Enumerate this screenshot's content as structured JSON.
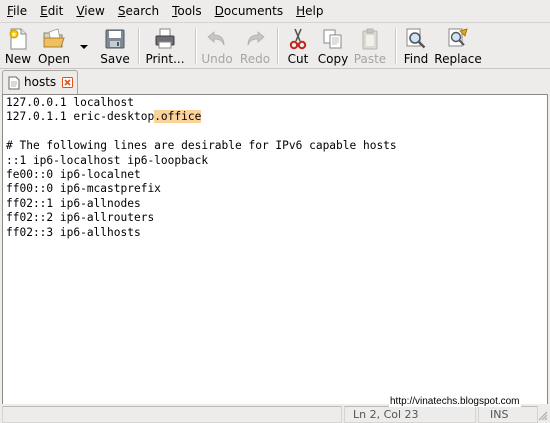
{
  "menubar": {
    "items": [
      {
        "mnemonic": "F",
        "rest": "ile"
      },
      {
        "mnemonic": "E",
        "rest": "dit"
      },
      {
        "mnemonic": "V",
        "rest": "iew"
      },
      {
        "mnemonic": "S",
        "rest": "earch"
      },
      {
        "mnemonic": "T",
        "rest": "ools"
      },
      {
        "mnemonic": "D",
        "rest": "ocuments"
      },
      {
        "mnemonic": "H",
        "rest": "elp"
      }
    ]
  },
  "toolbar": {
    "new_label": "New",
    "open_label": "Open",
    "save_label": "Save",
    "print_label": "Print...",
    "undo_label": "Undo",
    "redo_label": "Redo",
    "cut_label": "Cut",
    "copy_label": "Copy",
    "paste_label": "Paste",
    "find_label": "Find",
    "replace_label": "Replace"
  },
  "tab": {
    "label": "hosts"
  },
  "editor": {
    "lines": [
      {
        "text": "127.0.0.1 localhost"
      },
      {
        "text": "127.0.1.1 eric-desktop",
        "selected": ".office"
      },
      {
        "text": ""
      },
      {
        "text": "# The following lines are desirable for IPv6 capable hosts"
      },
      {
        "text": "::1 ip6-localhost ip6-loopback"
      },
      {
        "text": "fe00::0 ip6-localnet"
      },
      {
        "text": "ff00::0 ip6-mcastprefix"
      },
      {
        "text": "ff02::1 ip6-allnodes"
      },
      {
        "text": "ff02::2 ip6-allrouters"
      },
      {
        "text": "ff02::3 ip6-allhosts"
      }
    ]
  },
  "statusbar": {
    "position": "Ln 2, Col 23",
    "mode": "INS"
  },
  "watermark": "http://vinatechs.blogspot.com",
  "colors": {
    "selection": "#fcd29b",
    "tab_close": "#e0521b",
    "cut_red": "#c4261f"
  }
}
